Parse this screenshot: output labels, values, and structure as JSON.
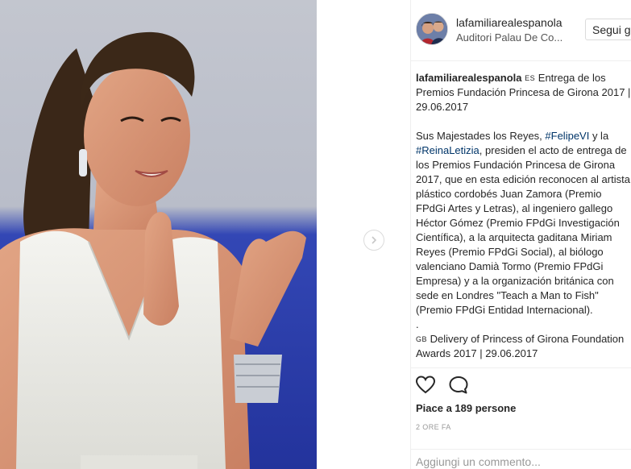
{
  "header": {
    "username": "lafamiliarealespanola",
    "location": "Auditori Palau De Co...",
    "follow_label": "Segui già"
  },
  "caption": {
    "username": "lafamiliarealespanola",
    "flag_es": "ES",
    "title": "Entrega de los Premios Fundación Princesa de Girona 2017 | 29.06.2017",
    "p2_a": "Sus Majestades los Reyes, ",
    "hashtag1": "#FelipeVI",
    "p2_b": " y la ",
    "hashtag2": "#ReinaLetizia",
    "p2_c": ", presiden el acto de entrega de los Premios Fundación Princesa de Girona 2017, que en esta edición reconocen al artista plástico cordobés Juan Zamora (Premio FPdGi Artes y Letras), al ingeniero gallego Héctor Gómez (Premio FPdGi Investigación Científica), a la arquitecta gaditana Miriam Reyes (Premio FPdGi Social), al biólogo valenciano Damià Tormo (Premio FPdGi Empresa) y a la organización británica con sede en Londres \"Teach a Man to Fish\" (Premio FPdGi Entidad Internacional).",
    "dot": ".",
    "flag_gb": "GB",
    "english": "Delivery of Princess of Girona Foundation Awards 2017 | 29.06.2017"
  },
  "actions": {
    "likes": "Piace a 189 persone",
    "time": "2 ORE FA"
  },
  "comment": {
    "placeholder": "Aggiungi un commento..."
  },
  "icons": {
    "like": "heart-icon",
    "comment": "comment-bubble-icon",
    "next": "chevron-right-icon"
  },
  "colors": {
    "hashtag": "#003569",
    "text": "#262626",
    "muted": "#999999",
    "border": "#efefef"
  }
}
